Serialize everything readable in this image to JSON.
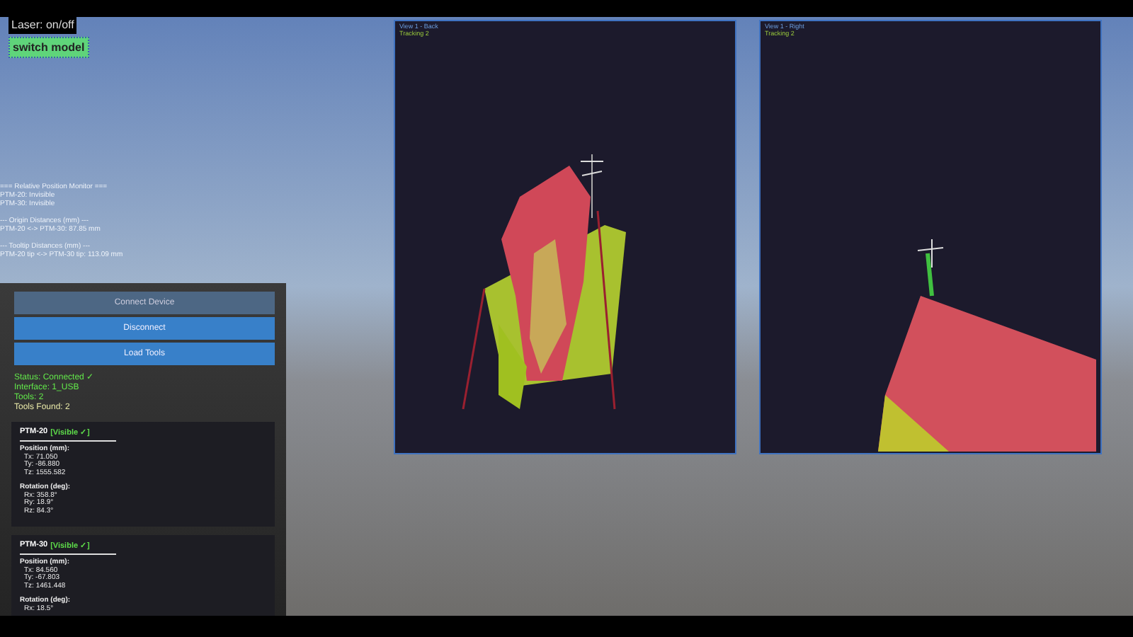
{
  "laser_label": "Laser: on/off",
  "switch_button": "switch model",
  "monitor_groups": [
    [
      "=== Relative Position Monitor ===",
      "PTM-20: Invisible",
      "PTM-30: Invisible"
    ],
    [
      "--- Origin Distances (mm) ---",
      "PTM-20 <-> PTM-30: 87.85 mm"
    ],
    [
      "--- Tooltip Distances (mm) ---",
      "PTM-20 tip <-> PTM-30 tip: 113.09 mm"
    ]
  ],
  "buttons": [
    {
      "label": "Connect Device",
      "disabled": true
    },
    {
      "label": "Disconnect",
      "disabled": false
    },
    {
      "label": "Load Tools",
      "disabled": false
    }
  ],
  "status_lines": [
    {
      "text": "Status: Connected ✓",
      "kind": "status"
    },
    {
      "text": "Interface: 1_USB",
      "kind": "status"
    },
    {
      "text": "Tools: 2",
      "kind": "status"
    },
    {
      "text": "Tools Found: 2",
      "kind": "info"
    }
  ],
  "tools": [
    {
      "name": "PTM-20",
      "status": "[Visible ✓]",
      "visible": true,
      "position_label": "Position (mm):",
      "position": [
        "Tx: 71.050",
        "Ty: -86.880",
        "Tz: 1555.582"
      ],
      "rotation_label": "Rotation (deg):",
      "rotation": [
        "Rx: 358.8°",
        "Ry: 18.9°",
        "Rz: 84.3°"
      ]
    },
    {
      "name": "PTM-30",
      "status": "[Visible ✓]",
      "visible": true,
      "position_label": "Position (mm):",
      "position": [
        "Tx: 84.560",
        "Ty: -67.803",
        "Tz: 1461.448"
      ],
      "rotation_label": "Rotation (deg):",
      "rotation": [
        "Rx: 18.5°"
      ]
    }
  ],
  "views": [
    {
      "title": "View 1 - Back",
      "subtitle": "Tracking 2",
      "kind": "back"
    },
    {
      "title": "View 1 - Right",
      "subtitle": "Tracking 2",
      "kind": "right"
    }
  ]
}
